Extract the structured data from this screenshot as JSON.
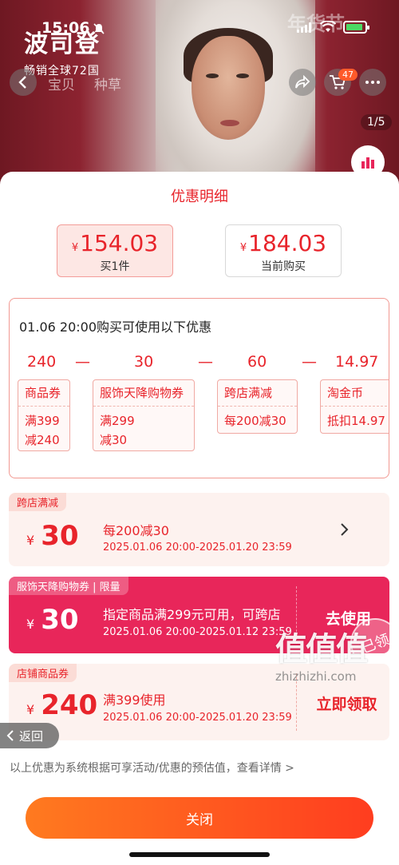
{
  "status_bar": {
    "time": "15:06"
  },
  "background": {
    "brand_name": "波司登",
    "brand_sub": "畅销全球72国",
    "promo_badge": "年货节",
    "nav_tabs": [
      "宝贝",
      "种草"
    ],
    "cart_count": "47",
    "page_indicator": "1/5"
  },
  "sheet": {
    "title": "优惠明细",
    "prices": [
      {
        "yen": "¥",
        "value": "154.03",
        "label": "买1件",
        "selected": true
      },
      {
        "yen": "¥",
        "value": "184.03",
        "label": "当前购买",
        "selected": false
      }
    ],
    "breakdown": {
      "heading": "01.06 20:00购买可使用以下优惠",
      "amounts": [
        "240",
        "30",
        "60",
        "14.97"
      ],
      "operator": "—",
      "cards": [
        {
          "title": "商品券",
          "lines": [
            "满399",
            "减240"
          ]
        },
        {
          "title": "服饰天降购物券",
          "lines": [
            "满299",
            "减30"
          ]
        },
        {
          "title": "跨店满减",
          "lines": [
            "每200减30"
          ]
        },
        {
          "title": "淘金币",
          "lines": [
            "抵扣14.97"
          ]
        }
      ]
    },
    "coupons": [
      {
        "tag": "跨店满减",
        "yen": "¥",
        "amount": "30",
        "desc": "每200减30",
        "date": "2025.01.06 20:00-2025.01.20 23:59"
      },
      {
        "tag": "服饰天降购物券 | 限量",
        "yen": "¥",
        "amount": "30",
        "desc": "指定商品满299元可用，可跨店",
        "date": "2025.01.06 20:00-2025.01.12 23:59",
        "action": "去使用",
        "stamp": "已领"
      },
      {
        "tag": "店铺商品券",
        "yen": "¥",
        "amount": "240",
        "desc": "满399使用",
        "date": "2025.01.06 20:00-2025.01.20 23:59",
        "action": "立即领取"
      }
    ],
    "back_label": "返回",
    "footer_note": "以上优惠为系统根据可享活动/优惠的预估值，查看详情 >",
    "close_label": "关闭"
  },
  "watermark": {
    "logo": "值值值",
    "url": "zhizhizhi.com"
  },
  "colors": {
    "accent_red": "#e8242b",
    "coupon_pink": "#e8265a",
    "button_orange": "#ff5b1f"
  }
}
